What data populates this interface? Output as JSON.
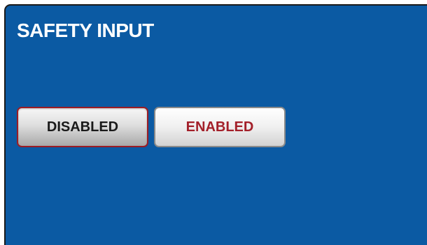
{
  "panel": {
    "title": "SAFETY INPUT"
  },
  "toggle": {
    "options": [
      {
        "label": "DISABLED",
        "selected": true
      },
      {
        "label": "ENABLED",
        "selected": false
      }
    ]
  },
  "colors": {
    "panel_background": "#0b5aa3",
    "selected_border": "#9b1c24",
    "enabled_text": "#a3202a"
  }
}
